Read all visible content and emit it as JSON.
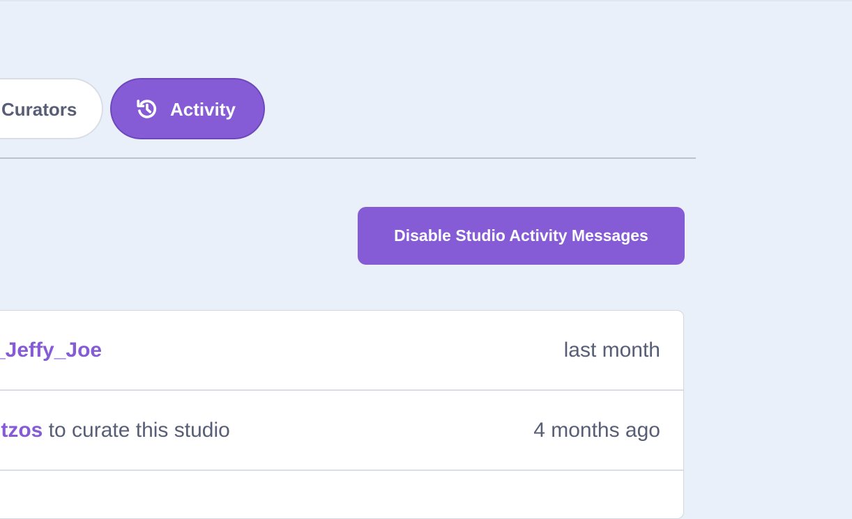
{
  "tabs": [
    {
      "label": "Curators",
      "active": false
    },
    {
      "label": "Activity",
      "active": true,
      "icon": "history-icon"
    }
  ],
  "activity": {
    "disable_button_label": "Disable Studio Activity Messages",
    "items": [
      {
        "user": "_Jeffy_Joe",
        "text": "",
        "time": "last month"
      },
      {
        "user": "ntzos",
        "text": " to curate this studio",
        "time": "4 months ago"
      }
    ]
  },
  "colors": {
    "background": "#e9f0fa",
    "accent": "#855cd6",
    "text": "#575e75"
  }
}
